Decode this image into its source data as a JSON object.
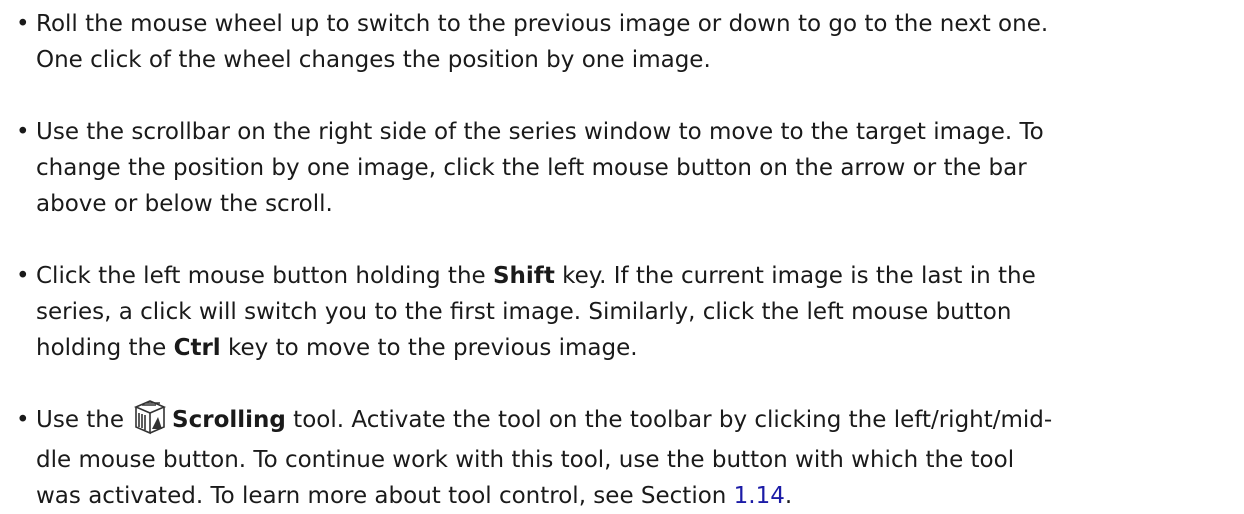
{
  "bullet_glyph": "•",
  "items": [
    {
      "lines": [
        "Roll the mouse wheel up to switch to the previous image or down to go to the next one.",
        "One click of the wheel changes the position by one image."
      ]
    },
    {
      "lines": [
        "Use the scrollbar on the right side of the series window to move to the target image. To",
        "change the position by one image, click the left mouse button on the arrow or the bar",
        "above or below the scroll."
      ]
    },
    {
      "line1_pre": "Click the left mouse button holding the ",
      "line1_bold": "Shift",
      "line1_post": " key. If the current image is the last in the",
      "line2": "series, a click will switch you to the first image. Similarly, click the left mouse button",
      "line3_pre": "holding the ",
      "line3_bold": "Ctrl",
      "line3_post": " key to move to the previous image."
    },
    {
      "line1_pre": "Use the",
      "icon": "scrolling-tool-icon",
      "line1_bold": "Scrolling",
      "line1_post": " tool. Activate the tool on the toolbar by clicking the left/right/mid-",
      "line2": "dle mouse button. To continue work with this tool, use the button with which the tool",
      "line3_pre": "was activated. To learn more about tool control, see Section ",
      "line3_link": "1.14",
      "line3_post": "."
    }
  ]
}
